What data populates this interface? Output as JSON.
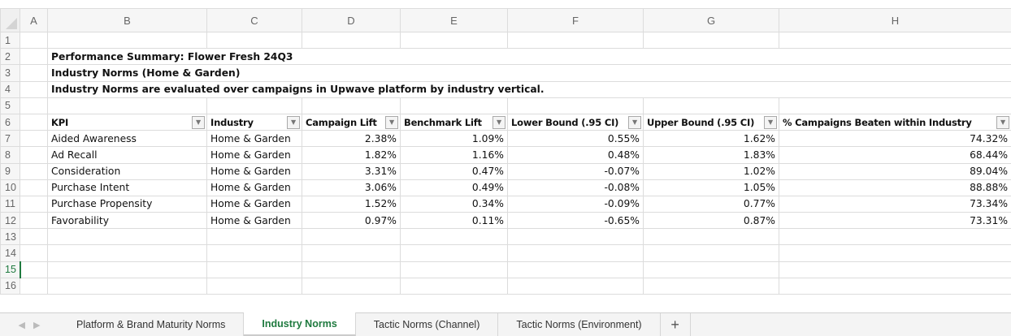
{
  "columns": [
    "A",
    "B",
    "C",
    "D",
    "E",
    "F",
    "G",
    "H"
  ],
  "rows": [
    "1",
    "2",
    "3",
    "4",
    "5",
    "6",
    "7",
    "8",
    "9",
    "10",
    "11",
    "12",
    "13",
    "14",
    "15",
    "16"
  ],
  "selected_row": "15",
  "title_lines": [
    "Performance Summary: Flower Fresh 24Q3",
    "Industry Norms (Home & Garden)",
    "Industry Norms are evaluated over campaigns in Upwave platform by industry vertical."
  ],
  "headers": [
    "KPI",
    "Industry",
    "Campaign Lift",
    "Benchmark Lift",
    "Lower Bound (.95 CI)",
    "Upper Bound (.95 CI)",
    "% Campaigns Beaten within Industry"
  ],
  "data": [
    [
      "Aided Awareness",
      "Home & Garden",
      "2.38%",
      "1.09%",
      "0.55%",
      "1.62%",
      "74.32%"
    ],
    [
      "Ad Recall",
      "Home & Garden",
      "1.82%",
      "1.16%",
      "0.48%",
      "1.83%",
      "68.44%"
    ],
    [
      "Consideration",
      "Home & Garden",
      "3.31%",
      "0.47%",
      "-0.07%",
      "1.02%",
      "89.04%"
    ],
    [
      "Purchase Intent",
      "Home & Garden",
      "3.06%",
      "0.49%",
      "-0.08%",
      "1.05%",
      "88.88%"
    ],
    [
      "Purchase Propensity",
      "Home & Garden",
      "1.52%",
      "0.34%",
      "-0.09%",
      "0.77%",
      "73.34%"
    ],
    [
      "Favorability",
      "Home & Garden",
      "0.97%",
      "0.11%",
      "-0.65%",
      "0.87%",
      "73.31%"
    ]
  ],
  "sheets": [
    "Platform & Brand Maturity Norms",
    "Industry Norms",
    "Tactic Norms (Channel)",
    "Tactic Norms (Environment)"
  ],
  "active_sheet": "Industry Norms",
  "add_sheet": "+",
  "filter_glyph": "▼",
  "nav": {
    "prev": "◀",
    "next": "▶"
  }
}
